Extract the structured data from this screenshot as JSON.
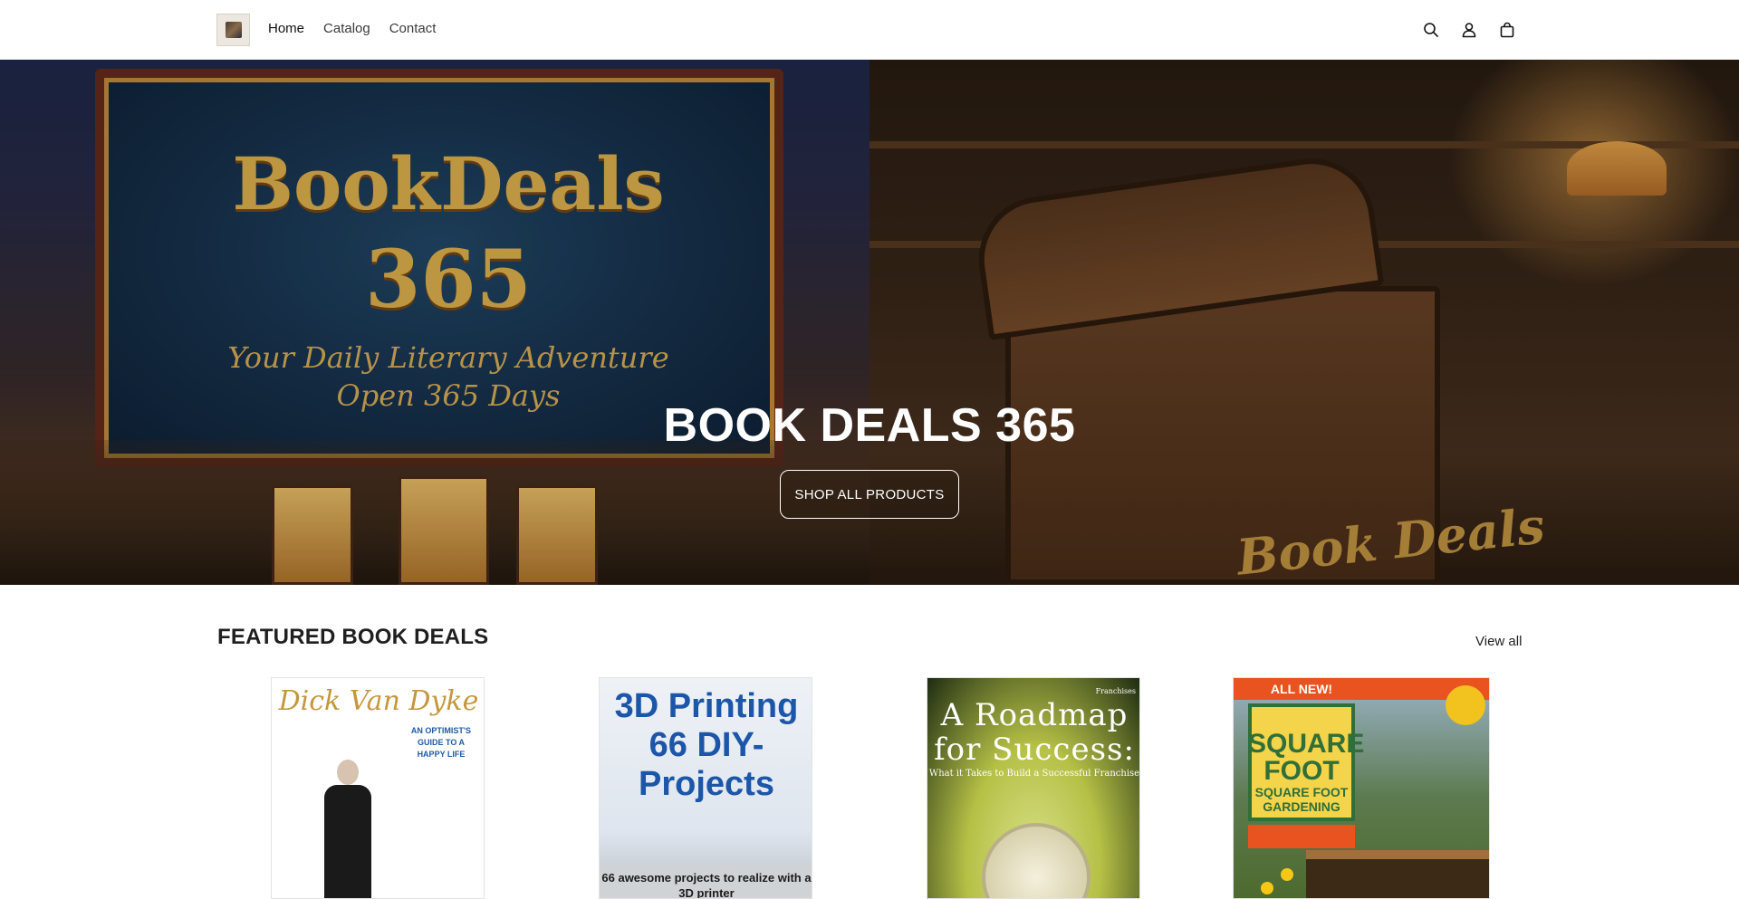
{
  "header": {
    "nav": [
      {
        "label": "Home",
        "active": true
      },
      {
        "label": "Catalog",
        "active": false
      },
      {
        "label": "Contact",
        "active": false
      }
    ],
    "icons": [
      "search-icon",
      "account-icon",
      "cart-icon"
    ]
  },
  "hero": {
    "sign_title_1": "BookDeals",
    "sign_title_2": "365",
    "sign_sub_1": "Your Daily Literary Adventure",
    "sign_sub_2": "Open 365 Days",
    "chest_text": "Book Deals",
    "title": "BOOK DEALS 365",
    "button_label": "SHOP ALL PRODUCTS"
  },
  "featured": {
    "title": "FEATURED BOOK DEALS",
    "view_all": "View all",
    "books": [
      {
        "name": "Dick Van Dyke",
        "tag": "AN OPTIMIST'S GUIDE TO A HAPPY LIFE"
      },
      {
        "name": "3D Printing 66 DIY-Projects",
        "sub": "66 awesome projects to realize with a 3D printer"
      },
      {
        "name": "A Roadmap for Success:",
        "top": "Franchises",
        "sub": "What it Takes to Build a Successful Franchise"
      },
      {
        "name": "SQUARE FOOT GARDENING",
        "top": "ALL NEW!",
        "title_1": "SQUARE",
        "title_2": "FOOT"
      }
    ]
  },
  "colors": {
    "accent_gold": "#e6b74f",
    "cover_blue": "#1c56a8",
    "gardening_orange": "#e9531f"
  }
}
